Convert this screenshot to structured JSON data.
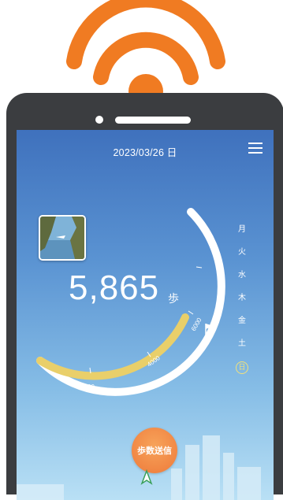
{
  "colors": {
    "wifi": "#f07b22",
    "gauge_fill": "#e9cf6a",
    "phone": "#3b3d40"
  },
  "header": {
    "date": "2023/03/26 日",
    "menu_icon": "hamburger-menu-icon"
  },
  "counter": {
    "steps": "5,865",
    "unit": "歩"
  },
  "gauge": {
    "tick_labels": [
      "2000",
      "4000",
      "6000"
    ],
    "goal": 6000,
    "current": 5865,
    "goal_icon": "goal-flag-icon"
  },
  "weekdays": {
    "items": [
      "月",
      "火",
      "水",
      "木",
      "金",
      "土",
      "日"
    ],
    "today_index": 6
  },
  "send_button": {
    "label": "歩数送信"
  }
}
